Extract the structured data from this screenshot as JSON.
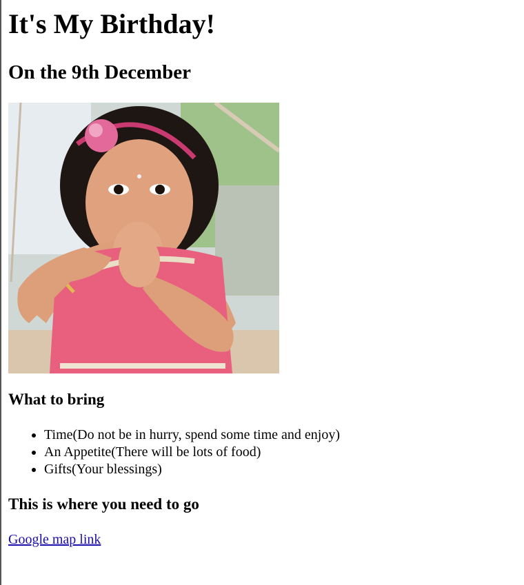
{
  "heading": "It's My Birthday!",
  "subheading": "On the 9th December",
  "bring": {
    "title": "What to bring",
    "items": [
      "Time(Do not be in hurry, spend some time and enjoy)",
      "An Appetite(There will be lots of food)",
      "Gifts(Your blessings)"
    ]
  },
  "directions": {
    "title": "This is where you need to go",
    "link_text": "Google map link"
  },
  "colors": {
    "link": "#1a0dab",
    "dress": "#e8607e",
    "background": "#ffffff"
  }
}
